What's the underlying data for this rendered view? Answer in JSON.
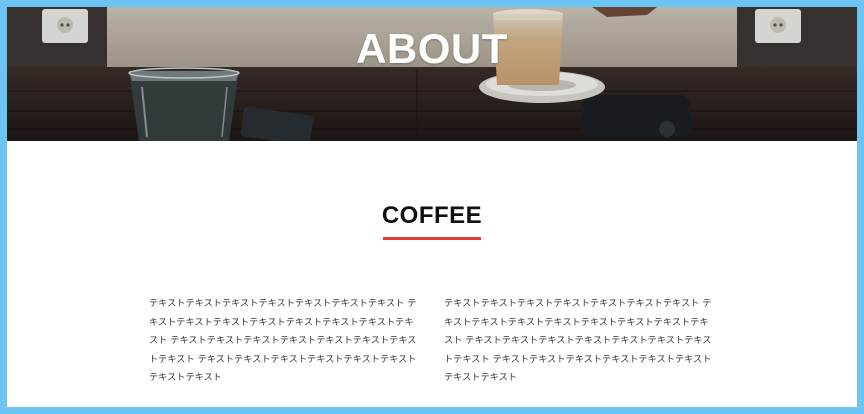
{
  "hero": {
    "title": "ABOUT",
    "image_alt": "coffee-cup-on-wooden-table-photo"
  },
  "section": {
    "title": "COFFEE",
    "accent_color": "#e03a3a"
  },
  "columns": [
    {
      "text": "テキストテキストテキストテキストテキストテキストテキスト テキストテキストテキストテキストテキストテキストテキストテキスト テキストテキストテキストテキストテキストテキストテキストテキスト テキストテキストテキストテキストテキストテキストテキストテキスト"
    },
    {
      "text": "テキストテキストテキストテキストテキストテキストテキスト テキストテキストテキストテキストテキストテキストテキストテキスト テキストテキストテキストテキストテキストテキストテキストテキスト テキストテキストテキストテキストテキストテキストテキストテキスト"
    }
  ],
  "colors": {
    "page_border": "#6cc4f2",
    "background": "#ffffff",
    "text": "#333333",
    "heading": "#111111"
  }
}
